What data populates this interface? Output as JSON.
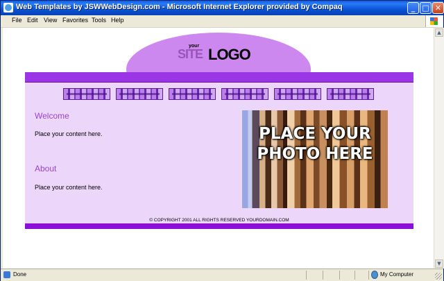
{
  "window": {
    "title": "Web Templates by JSWWebDesign.com - Microsoft Internet Explorer provided by Compaq",
    "min_glyph": "_",
    "max_glyph": "□",
    "close_glyph": "✕"
  },
  "menu": {
    "items": [
      "File",
      "Edit",
      "View",
      "Favorites",
      "Tools",
      "Help"
    ]
  },
  "page": {
    "logo": {
      "small": "your",
      "site": "SITE",
      "main": "LOGO"
    },
    "sections": [
      {
        "heading": "Welcome",
        "body": "Place your content here."
      },
      {
        "heading": "About",
        "body": "Place your content here."
      }
    ],
    "photo_placeholder": "PLACE YOUR PHOTO HERE",
    "copyright": "© COPYRIGHT 2001 ALL RIGHTS RESERVED YOURDOMAIN.COM"
  },
  "status": {
    "text": "Done",
    "zone": "My Computer"
  },
  "colors": {
    "accent": "#9a36e6",
    "panel": "#ecd6fa",
    "heading": "#9945d0"
  }
}
